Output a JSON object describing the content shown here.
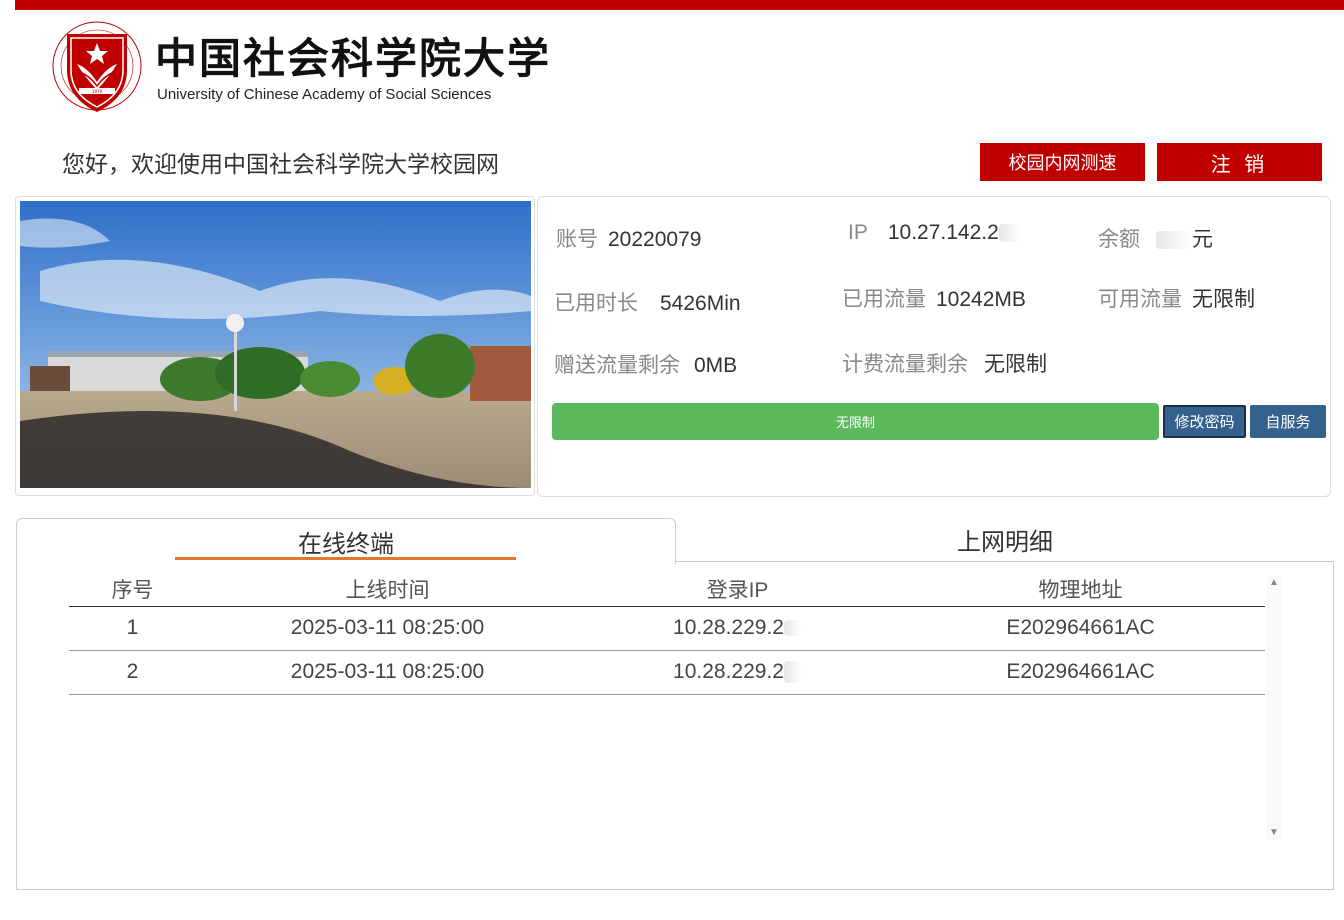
{
  "header": {
    "logo_cn": "中国社会科学院大学",
    "logo_en": "University of Chinese Academy of Social Sciences",
    "emblem_year": "1978",
    "welcome": "您好，欢迎使用中国社会科学院大学校园网",
    "speed_test_label": "校园内网测速",
    "logout_label": "注 销"
  },
  "account": {
    "account_label": "账号",
    "account_value": "20220079",
    "ip_label": "IP",
    "ip_value": "10.27.142.2",
    "balance_label": "余额",
    "balance_unit": "元",
    "used_time_label": "已用时长",
    "used_time_value": "5426Min",
    "used_traffic_label": "已用流量",
    "used_traffic_value": "10242MB",
    "available_traffic_label": "可用流量",
    "available_traffic_value": "无限制",
    "gift_traffic_label": "赠送流量剩余",
    "gift_traffic_value": "0MB",
    "billed_traffic_label": "计费流量剩余",
    "billed_traffic_value": "无限制",
    "progress_label": "无限制",
    "progress_fraction": 1.0,
    "change_password_label": "修改密码",
    "self_service_label": "自服务"
  },
  "tabs": {
    "online_terminals": "在线终端",
    "network_details": "上网明细"
  },
  "table": {
    "headers": [
      "序号",
      "上线时间",
      "登录IP",
      "物理地址"
    ],
    "rows": [
      [
        "1",
        "2025-03-11 08:25:00",
        "10.28.229.2",
        "E202964661AC"
      ],
      [
        "2",
        "2025-03-11 08:25:00",
        "10.28.229.2",
        "E202964661AC"
      ]
    ]
  },
  "colors": {
    "brand_red": "#c00000",
    "progress_green": "#5cb85c",
    "button_blue": "#34618e",
    "tab_accent": "#e07a2e"
  }
}
